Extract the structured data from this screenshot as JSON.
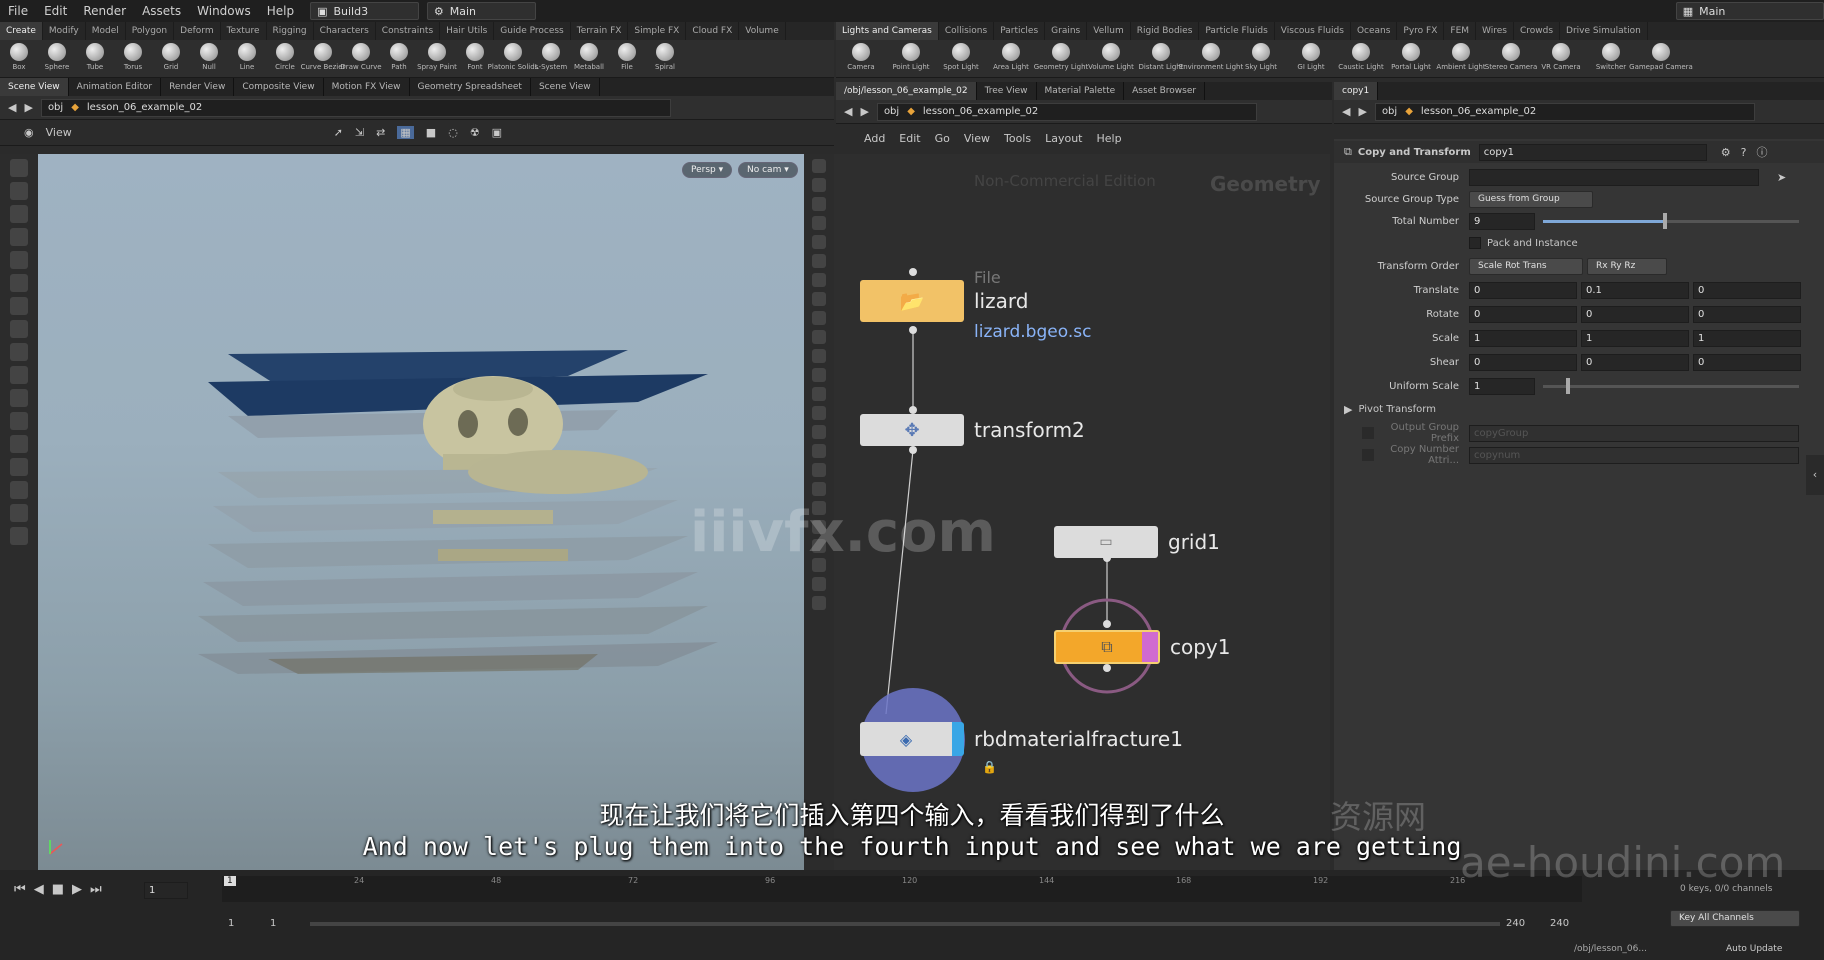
{
  "menubar": {
    "items": [
      "File",
      "Edit",
      "Render",
      "Assets",
      "Windows",
      "Help"
    ],
    "desktop": "Build3",
    "main_left": "Main",
    "main_right": "Main"
  },
  "shelf_left": {
    "tabs": [
      "Create",
      "Modify",
      "Model",
      "Polygon",
      "Deform",
      "Texture",
      "Rigging",
      "Characters",
      "Constraints",
      "Hair Utils",
      "Guide Process",
      "Terrain FX",
      "Simple FX",
      "Cloud FX",
      "Volume"
    ],
    "tools": [
      "Box",
      "Sphere",
      "Tube",
      "Torus",
      "Grid",
      "Null",
      "Line",
      "Circle",
      "Curve Bezier",
      "Draw Curve",
      "Path",
      "Spray Paint",
      "Font",
      "Platonic Solids",
      "L-System",
      "Metaball",
      "File",
      "Spiral"
    ]
  },
  "shelf_right": {
    "tabs": [
      "Lights and Cameras",
      "Collisions",
      "Particles",
      "Grains",
      "Vellum",
      "Rigid Bodies",
      "Particle Fluids",
      "Viscous Fluids",
      "Oceans",
      "Pyro FX",
      "FEM",
      "Wires",
      "Crowds",
      "Drive Simulation"
    ],
    "tools": [
      "Camera",
      "Point Light",
      "Spot Light",
      "Area Light",
      "Geometry Light",
      "Volume Light",
      "Distant Light",
      "Environment Light",
      "Sky Light",
      "GI Light",
      "Caustic Light",
      "Portal Light",
      "Ambient Light",
      "Stereo Camera",
      "VR Camera",
      "Switcher",
      "Gamepad Camera"
    ]
  },
  "left_pane": {
    "tabs": [
      "Scene View",
      "Animation Editor",
      "Render View",
      "Composite View",
      "Motion FX View",
      "Geometry Spreadsheet",
      "Scene View"
    ],
    "path_obj": "obj",
    "path_net": "lesson_06_example_02",
    "view_label": "View",
    "persp": "Persp ▾",
    "cam": "No cam ▾"
  },
  "mid_pane": {
    "tabs": [
      "/obj/lesson_06_example_02",
      "Tree View",
      "Material Palette",
      "Asset Browser"
    ],
    "path_obj": "obj",
    "path_net": "lesson_06_example_02",
    "menu": [
      "Add",
      "Edit",
      "Go",
      "View",
      "Tools",
      "Layout",
      "Help"
    ],
    "watermark_edition": "Non-Commercial Edition",
    "watermark_context": "Geometry",
    "nodes": {
      "file_type": "File",
      "file_name": "lizard",
      "file_path": "lizard.bgeo.sc",
      "transform": "transform2",
      "grid": "grid1",
      "copy": "copy1",
      "rbd": "rbdmaterialfracture1"
    }
  },
  "right_pane": {
    "tabs": [
      "copy1"
    ],
    "path_obj": "obj",
    "path_net": "lesson_06_example_02",
    "node_type": "Copy and Transform",
    "node_name": "copy1",
    "params": {
      "source_group_label": "Source Group",
      "source_group_type_label": "Source Group Type",
      "source_group_type": "Guess from Group",
      "total_number_label": "Total Number",
      "total_number": "9",
      "pack_label": "Pack and Instance",
      "transform_order_label": "Transform Order",
      "transform_order": "Scale Rot Trans",
      "rot_order": "Rx Ry Rz",
      "translate_label": "Translate",
      "translate": [
        "0",
        "0.1",
        "0"
      ],
      "rotate_label": "Rotate",
      "rotate": [
        "0",
        "0",
        "0"
      ],
      "scale_label": "Scale",
      "scale": [
        "1",
        "1",
        "1"
      ],
      "shear_label": "Shear",
      "shear": [
        "0",
        "0",
        "0"
      ],
      "uniform_scale_label": "Uniform Scale",
      "uniform_scale": "1",
      "pivot_label": "Pivot Transform",
      "output_group_prefix_label": "Output Group Prefix",
      "output_group_prefix_ph": "copyGroup",
      "copy_number_label": "Copy Number Attri...",
      "copy_number_ph": "copynum"
    }
  },
  "timeline": {
    "frame": "1",
    "frame_field": "1",
    "ticks": [
      "24",
      "48",
      "72",
      "96",
      "120",
      "144",
      "168",
      "192",
      "216"
    ],
    "range_start": "1",
    "range_start2": "1",
    "range_end": "240",
    "range_end2": "240",
    "keys": "0 keys, 0/0 channels",
    "key_all": "Key All Channels",
    "status_path": "/obj/lesson_06...",
    "auto_update": "Auto Update"
  },
  "overlay": {
    "subtitle_cn": "现在让我们将它们插入第四个输入，看看我们得到了什么",
    "subtitle_en": "And now let's plug them into the fourth input and see what we are getting",
    "watermark1": "iiivfx.com",
    "watermark2": "资源网",
    "watermark3": "ae-houdini.com"
  },
  "colors": {
    "bg": "#2b2b2b",
    "viewport": "#9fb2c2",
    "file_node": "#f2c267",
    "copy_node": "#f3a72a",
    "link": "#8ab4f8"
  }
}
